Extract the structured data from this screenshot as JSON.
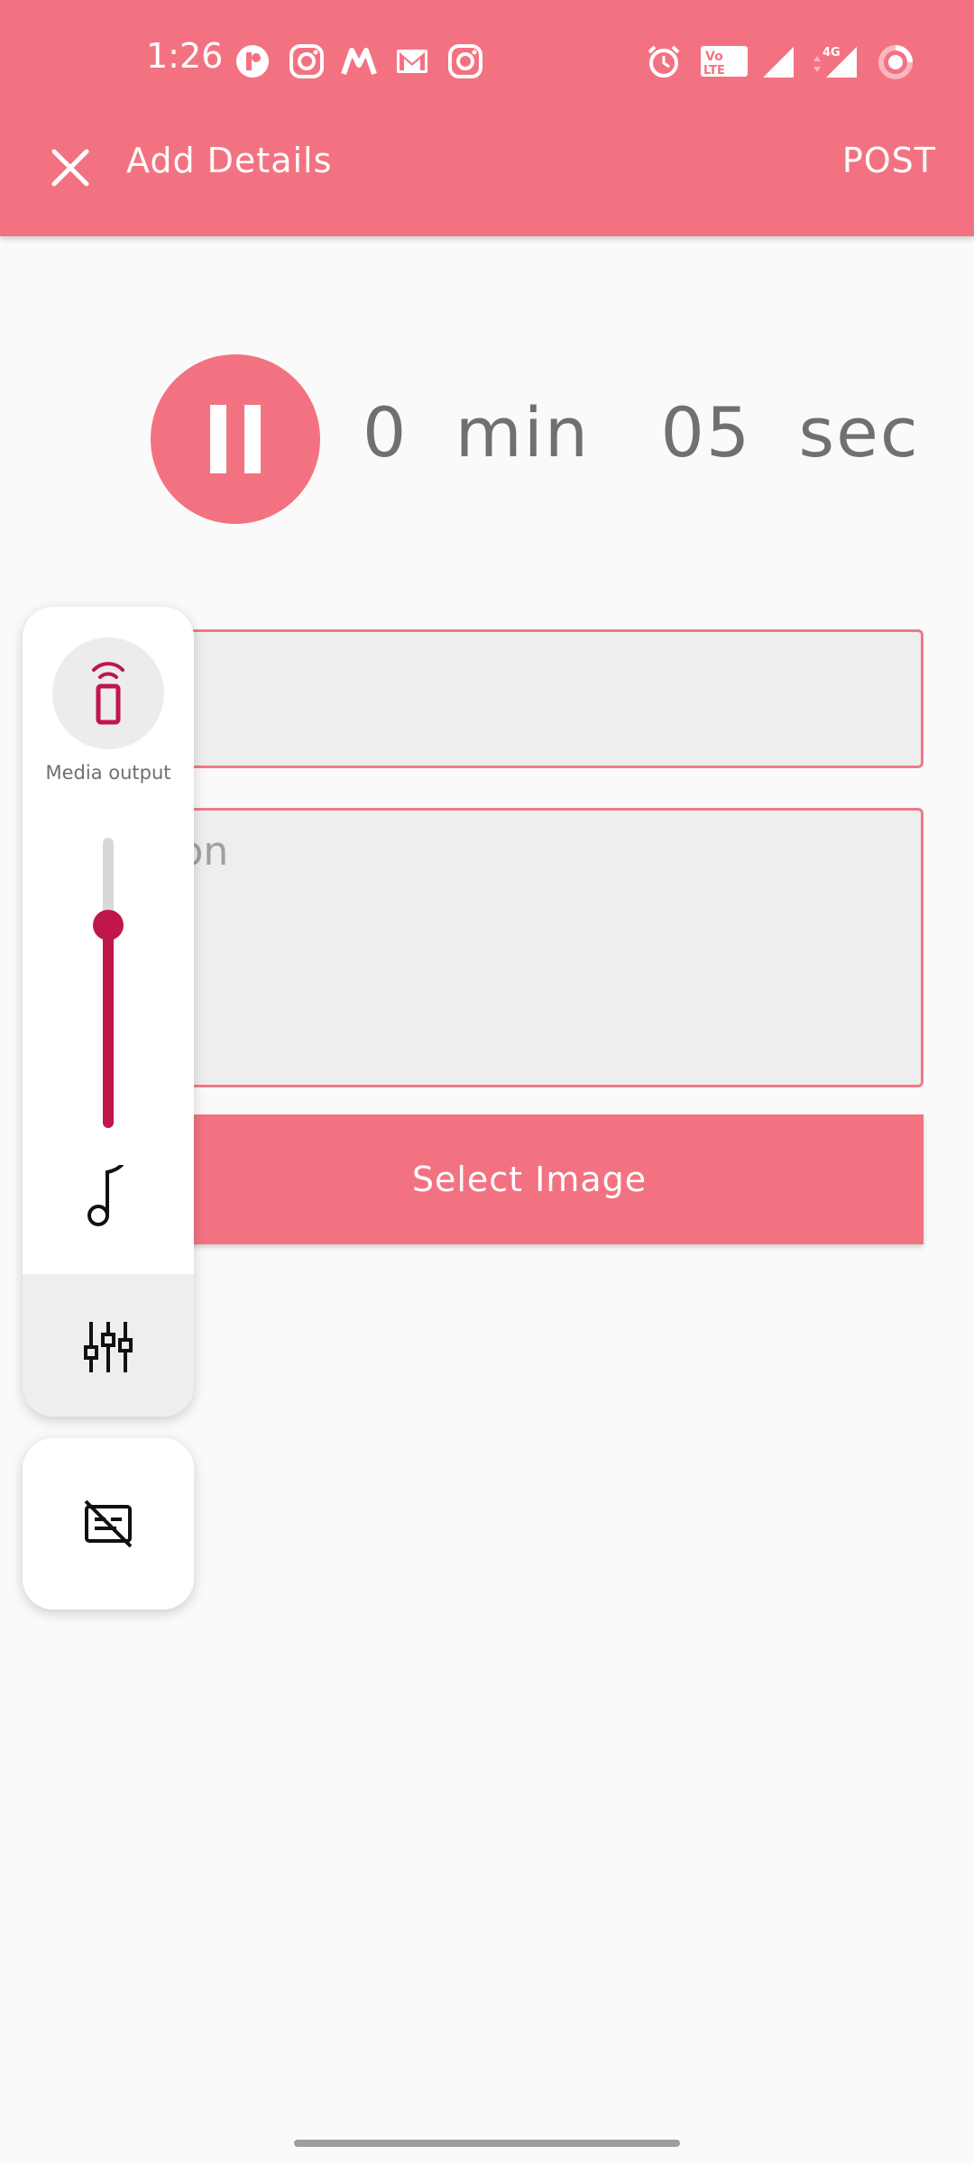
{
  "status_bar": {
    "time": "1:26",
    "icons": [
      "app-icon",
      "instagram-icon",
      "myntra-icon",
      "gmail-icon",
      "instagram-icon",
      "alarm-icon",
      "volte-icon",
      "signal-icon",
      "signal-4g-icon",
      "battery-icon"
    ],
    "network_label": "4G",
    "volte_label_1": "Vo",
    "volte_label_2": "LTE"
  },
  "toolbar": {
    "close_icon": "close-icon",
    "title": "Add Details",
    "post_label": "POST"
  },
  "recorder": {
    "button_icon": "pause-icon",
    "minutes": "0",
    "min_label": "min",
    "seconds": "05",
    "sec_label": "sec"
  },
  "form": {
    "title_value": "",
    "description_placeholder": "tion",
    "select_image_label": "Select Image"
  },
  "volume_panel": {
    "media_output_icon": "remote-device-icon",
    "media_output_label": "Media output",
    "volume_level": 0.7,
    "stream_icon": "music-note-icon",
    "settings_icon": "equalizer-icon",
    "captions_icon": "captions-off-icon"
  },
  "colors": {
    "accent": "#f37281",
    "volume_accent": "#c0164a",
    "field_border": "#f07a88",
    "field_bg": "#eeeeee"
  }
}
